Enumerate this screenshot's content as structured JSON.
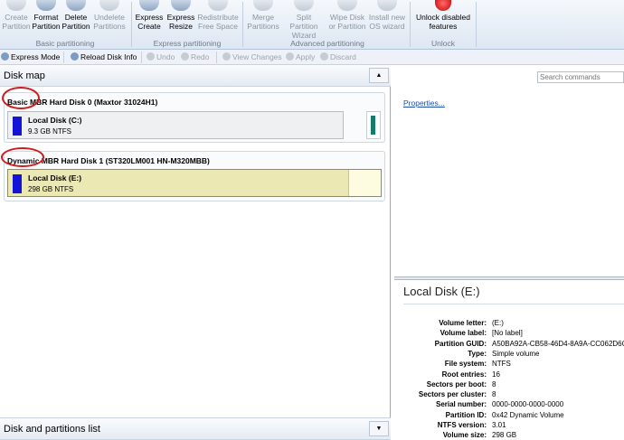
{
  "ribbon": {
    "buttons": [
      {
        "label": "Create\nPartition",
        "disabled": true
      },
      {
        "label": "Format\nPartition",
        "disabled": false
      },
      {
        "label": "Delete\nPartition",
        "disabled": false
      },
      {
        "label": "Undelete\nPartitions",
        "disabled": true
      },
      {
        "label": "Express\nCreate",
        "disabled": false
      },
      {
        "label": "Express\nResize",
        "disabled": false
      },
      {
        "label": "Redistribute\nFree Space",
        "disabled": true
      },
      {
        "label": "Merge\nPartitions",
        "disabled": true
      },
      {
        "label": "Split Partition\nWizard",
        "disabled": true
      },
      {
        "label": "Wipe Disk\nor Partition",
        "disabled": true
      },
      {
        "label": "Install new\nOS wizard",
        "disabled": true
      },
      {
        "label": "Unlock disabled\nfeatures",
        "disabled": false
      }
    ],
    "groups": [
      "Basic partitioning",
      "Express partitioning",
      "Advanced partitioning",
      "Unlock"
    ]
  },
  "toolbar": {
    "express_mode": "Express Mode",
    "reload": "Reload Disk Info",
    "undo": "Undo",
    "redo": "Redo",
    "view_changes": "View Changes",
    "apply": "Apply",
    "discard": "Discard"
  },
  "disk_map": {
    "title": "Disk map",
    "disks": [
      {
        "title": "Basic MBR Hard Disk 0 (Maxtor 31024H1)",
        "partition": {
          "name": "Local Disk (C:)",
          "info": "9.3 GB NTFS"
        }
      },
      {
        "title": "Dynamic MBR Hard Disk 1 (ST320LM001 HN-M320MBB)",
        "partition": {
          "name": "Local Disk (E:)",
          "info": "298 GB NTFS"
        }
      }
    ]
  },
  "list_panel": {
    "title": "Disk and partitions list"
  },
  "right": {
    "search_placeholder": "Search commands",
    "properties_link": "Properties...",
    "selected_title": "Local Disk (E:)",
    "properties": [
      {
        "k": "Volume letter:",
        "v": "(E:)"
      },
      {
        "k": "Volume label:",
        "v": "[No label]"
      },
      {
        "k": "Partition GUID:",
        "v": "A50BA92A-CB58-46D4-8A9A-CC062D6C"
      },
      {
        "k": "Type:",
        "v": "Simple volume"
      },
      {
        "k": "File system:",
        "v": "NTFS"
      },
      {
        "k": "Root entries:",
        "v": "16"
      },
      {
        "k": "Sectors per boot:",
        "v": "8"
      },
      {
        "k": "Sectors per cluster:",
        "v": "8"
      },
      {
        "k": "Serial number:",
        "v": "0000-0000-0000-0000"
      },
      {
        "k": "Partition ID:",
        "v": "0x42 Dynamic Volume"
      },
      {
        "k": "NTFS version:",
        "v": "3.01"
      },
      {
        "k": "Volume size:",
        "v": "298 GB"
      }
    ]
  },
  "colors": {
    "partition_bar": "#1414d6",
    "selected_partition": "#ece8b4",
    "annotation": "#d11a1a",
    "c_free_marker": "#147a6a"
  }
}
